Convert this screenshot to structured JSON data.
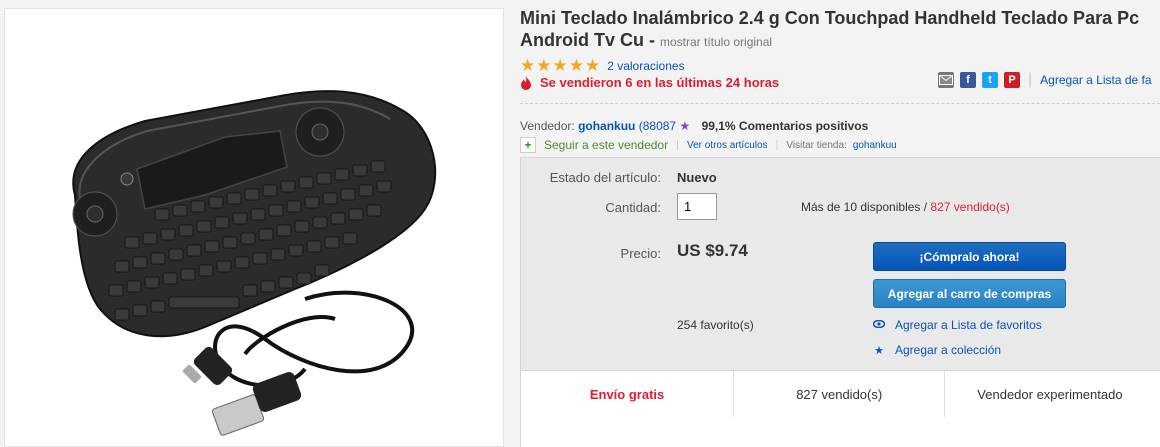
{
  "product": {
    "title": "Mini Teclado Inalámbrico 2.4 g Con Touchpad Handheld Teclado Para Pc Android Tv Cu -",
    "original_title_link": "mostrar título original",
    "stars": "★★★★★",
    "rating_count_label": "2 valoraciones",
    "sold_recent": "Se vendieron 6 en las últimas 24 horas"
  },
  "share": {
    "icons": [
      "email-icon",
      "facebook-icon",
      "twitter-icon",
      "pinterest-icon"
    ],
    "facebook_glyph": "f",
    "twitter_glyph": "t",
    "pinterest_glyph": "P",
    "watchlist_label": "Agregar a Lista de fa"
  },
  "seller": {
    "label": "Vendedor:",
    "name": "gohankuu",
    "score": "(88087",
    "positive": "99,1% Comentarios positivos",
    "follow": "Seguir a este vendedor",
    "other_items": "Ver otros artículos",
    "store_label": "Visitar tienda:",
    "store_name": "gohankuu"
  },
  "details": {
    "condition_label": "Estado del artículo:",
    "condition_value": "Nuevo",
    "quantity_label": "Cantidad:",
    "quantity_value": "1",
    "available": "Más de 10 disponibles /",
    "sold_count": "827 vendido(s)",
    "price_label": "Precio:",
    "price": "US $9.74",
    "buy_now": "¡Cómpralo ahora!",
    "add_cart": "Agregar al carro de compras",
    "watchers": "254 favorito(s)",
    "add_watchlist": "Agregar a Lista de favoritos",
    "add_collection": "Agregar a colección"
  },
  "highlights": {
    "shipping": "Envío gratis",
    "sold": "827 vendido(s)",
    "seller_badge": "Vendedor experimentado"
  },
  "colors": {
    "link": "#0654ba",
    "alert": "#dd1e31",
    "star": "#f5a623",
    "buy_button": "#0654ba",
    "cart_button": "#2a83c4"
  }
}
